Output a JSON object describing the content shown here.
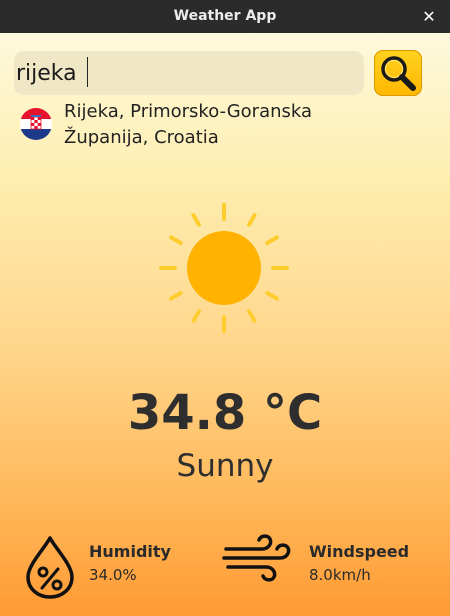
{
  "window": {
    "title": "Weather App",
    "close_glyph": "✕"
  },
  "search": {
    "value": "rijeka",
    "button_icon": "magnifier-icon"
  },
  "location": {
    "flag_icon": "croatia-flag-icon",
    "line1": "Rijeka, Primorsko-Goranska",
    "line2": "Županija, Croatia"
  },
  "weather": {
    "icon": "sun-icon",
    "temperature": "34.8 °C",
    "condition": "Sunny"
  },
  "stats": {
    "humidity": {
      "icon": "humidity-drop-icon",
      "label": "Humidity",
      "value": "34.0%"
    },
    "windspeed": {
      "icon": "wind-icon",
      "label": "Windspeed",
      "value": "8.0km/h"
    }
  },
  "colors": {
    "sun": "#ffb300",
    "sun_rays": "#ffcc2e",
    "button": "#ffc107",
    "text": "#2e2e2e"
  }
}
